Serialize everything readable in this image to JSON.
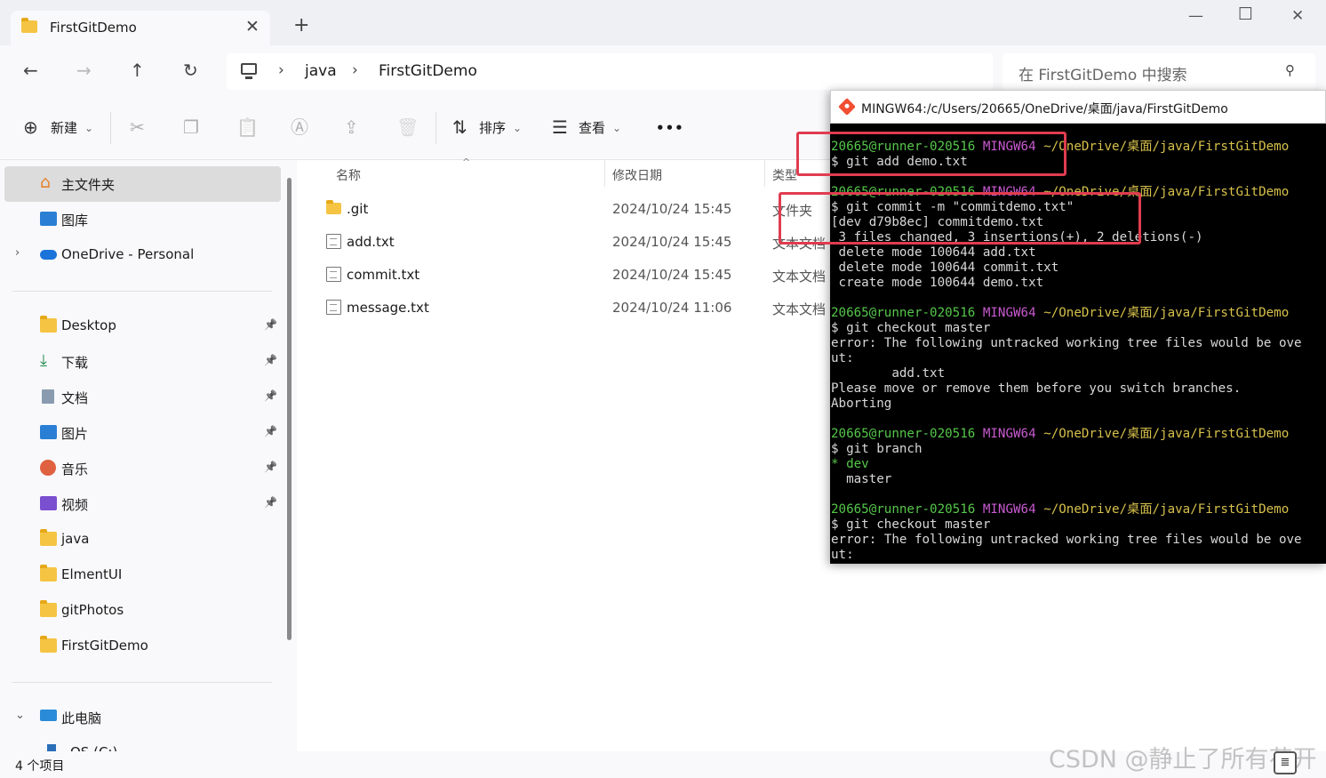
{
  "window": {
    "tab_title": "FirstGitDemo",
    "tab_close": "✕",
    "new_tab": "+",
    "minimize": "—",
    "maximize": "☐",
    "close": "✕"
  },
  "nav": {
    "back": "←",
    "forward": "→",
    "up": "↑",
    "refresh": "↻",
    "breadcrumb": [
      "java",
      "FirstGitDemo"
    ],
    "separator": "›",
    "search_placeholder": "在 FirstGitDemo 中搜索",
    "search_icon": "⚲"
  },
  "toolbar": {
    "new_label": "新建",
    "new_icon": "⊕",
    "cut_icon": "✂",
    "copy_icon": "❐",
    "paste_icon": "📋",
    "rename_icon": "Ⓐ",
    "share_icon": "⇪",
    "delete_icon": "🗑",
    "sort_label": "排序",
    "sort_icon": "⇅",
    "view_label": "查看",
    "view_icon": "☰",
    "more": "•••",
    "dropdown": "⌄"
  },
  "sidebar": {
    "home": "主文件夹",
    "gallery": "图库",
    "onedrive": "OneDrive - Personal",
    "quick_access": [
      "Desktop",
      "下载",
      "文档",
      "图片",
      "音乐",
      "视频",
      "java",
      "ElmentUI",
      "gitPhotos",
      "FirstGitDemo"
    ],
    "this_pc": "此电脑",
    "os_drive": "OS (C:)",
    "pin": "📌",
    "expand": "›",
    "collapse": "⌄"
  },
  "files": {
    "headers": {
      "name": "名称",
      "date": "修改日期",
      "type": "类型"
    },
    "sort_indicator": "^",
    "rows": [
      {
        "name": ".git",
        "date": "2024/10/24 15:45",
        "type": "文件夹"
      },
      {
        "name": "add.txt",
        "date": "2024/10/24 15:45",
        "type": "文本文档"
      },
      {
        "name": "commit.txt",
        "date": "2024/10/24 15:45",
        "type": "文本文档"
      },
      {
        "name": "message.txt",
        "date": "2024/10/24 11:06",
        "type": "文本文档"
      }
    ]
  },
  "status": {
    "count": "4 个项目"
  },
  "terminal": {
    "title": "MINGW64:/c/Users/20665/OneDrive/桌面/java/FirstGitDemo",
    "prompt": {
      "user": "20665@runner-020516",
      "sys": "MINGW64",
      "path": "~/OneDrive/桌面/java/FirstGitDemo"
    },
    "blocks": [
      {
        "cmd": "$ git add demo.txt",
        "out": []
      },
      {
        "cmd": "$ git commit -m \"commitdemo.txt\"",
        "out": [
          "[dev d79b8ec] commitdemo.txt",
          " 3 files changed, 3 insertions(+), 2 deletions(-)",
          " delete mode 100644 add.txt",
          " delete mode 100644 commit.txt",
          " create mode 100644 demo.txt"
        ]
      },
      {
        "cmd": "$ git checkout master",
        "out": [
          "error: The following untracked working tree files would be ove",
          "ut:",
          "        add.txt",
          "Please move or remove them before you switch branches.",
          "Aborting"
        ]
      },
      {
        "cmd": "$ git branch",
        "out": [
          "  master"
        ],
        "current_branch": "* dev"
      },
      {
        "cmd": "$ git checkout master",
        "out": [
          "error: The following untracked working tree files would be ove",
          "ut:"
        ]
      }
    ]
  },
  "watermark": "CSDN @静止了所有花开",
  "colors": {
    "highlight": "#e03c4f",
    "prompt_user": "#55c74a",
    "prompt_sys": "#c85ad0",
    "prompt_path": "#d6c04b"
  }
}
